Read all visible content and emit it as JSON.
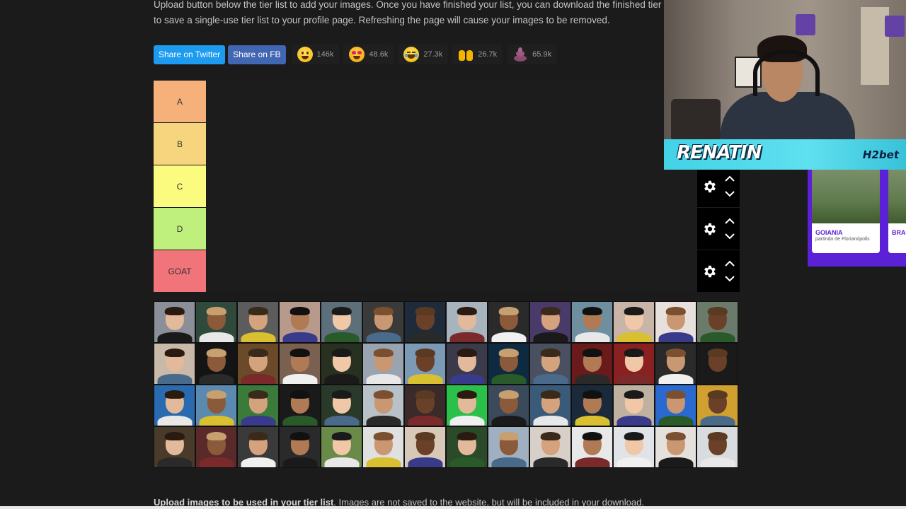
{
  "intro": {
    "line1": "Upload button below the tier list to add your images. Once you have finished your list, you can download the finished tier list image",
    "line2": "to save a single-use tier list to your profile page. Refreshing the page will cause your images to be removed."
  },
  "share": {
    "twitter_label": "Share on Twitter",
    "fb_label": "Share on FB"
  },
  "reactions": [
    {
      "icon": "grinning-face-icon",
      "count": "146k"
    },
    {
      "icon": "heart-eyes-face-icon",
      "count": "48.6k"
    },
    {
      "icon": "laughing-face-icon",
      "count": "27.3k"
    },
    {
      "icon": "raised-hands-icon",
      "count": "26.7k"
    },
    {
      "icon": "poop-icon",
      "count": "65.9k"
    }
  ],
  "tiers": [
    {
      "label": "A",
      "color": "#f6b07a"
    },
    {
      "label": "B",
      "color": "#f7d47e"
    },
    {
      "label": "C",
      "color": "#fbfb7f"
    },
    {
      "label": "D",
      "color": "#bfef7d"
    },
    {
      "label": "GOAT",
      "color": "#f0747a"
    }
  ],
  "bottom": {
    "bold": "Upload images to be used in your tier list",
    "rest": ". Images are not saved to the website, but will be included in your download."
  },
  "stream_overlay": {
    "streamer_name": "RENATIN",
    "sponsor_main": "H2",
    "sponsor_suffix": "bet"
  },
  "ad": {
    "card1_city": "GOIANIA",
    "card1_sub": "partindo de Florianópolis",
    "card2_city": "BRA"
  }
}
